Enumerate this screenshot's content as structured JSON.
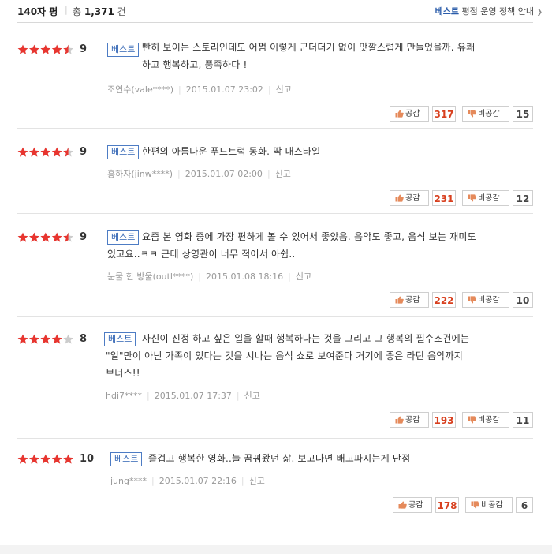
{
  "header": {
    "title": "140자 평",
    "total_prefix": "총",
    "total_count": "1,371",
    "total_suffix": "건",
    "policy_best": "베스트",
    "policy_text": "평점 운영 정책 안내",
    "policy_arrow": "❯"
  },
  "colors": {
    "star_on": "#e8352f",
    "star_off": "#cccccc",
    "badge": "#2f63b3",
    "sympathy_count": "#d8401f"
  },
  "labels": {
    "best": "베스트",
    "sympathy": "공감",
    "non_sympathy": "비공감",
    "report": "신고"
  },
  "reviews": [
    {
      "rating": 9,
      "score": "9",
      "text_lines": [
        "빤히 보이는 스토리인데도 어쩜 이렇게 군더더기 없이 맛깔스럽게 만들었을까. 유쾌",
        "하고 행복하고, 풍족하다 !"
      ],
      "author": "조연수(vale****)",
      "date": "2015.01.07 23:02",
      "sympathy": "317",
      "non_sympathy": "15"
    },
    {
      "rating": 9,
      "score": "9",
      "text_lines": [
        "한편의 아름다운 푸드트럭 동화. 딱 내스타일"
      ],
      "author": "홍하자(jinw****)",
      "date": "2015.01.07 02:00",
      "sympathy": "231",
      "non_sympathy": "12"
    },
    {
      "rating": 9,
      "score": "9",
      "text_lines": [
        "요즘 본 영화 중에 가장 편하게 볼 수 있어서 좋았음. 음악도 좋고, 음식 보는 재미도",
        "있고요..ㅋㅋ 근데 상영관이 너무 적어서 아쉽.."
      ],
      "author": "눈물 한 방울(outl****)",
      "date": "2015.01.08 18:16",
      "sympathy": "222",
      "non_sympathy": "10"
    },
    {
      "rating": 8,
      "score": "8",
      "text_lines": [
        "자신이 진정 하고 싶은 일을 할때 행복하다는 것을 그리고 그 행복의 필수조건에는",
        "\"일\"만이 아닌 가족이 있다는 것을 시나는 음식 쇼로 보여준다 거기에 좋은 라틴 음악까지",
        "보너스!!"
      ],
      "author": "hdi7****",
      "date": "2015.01.07 17:37",
      "sympathy": "193",
      "non_sympathy": "11"
    },
    {
      "rating": 10,
      "score": "10",
      "text_lines": [
        "즐겁고 행복한 영화..늘 꿈꿔왔던 삶. 보고나면 배고파지는게 단점"
      ],
      "author": "jung****",
      "date": "2015.01.07 22:16",
      "sympathy": "178",
      "non_sympathy": "6"
    }
  ]
}
